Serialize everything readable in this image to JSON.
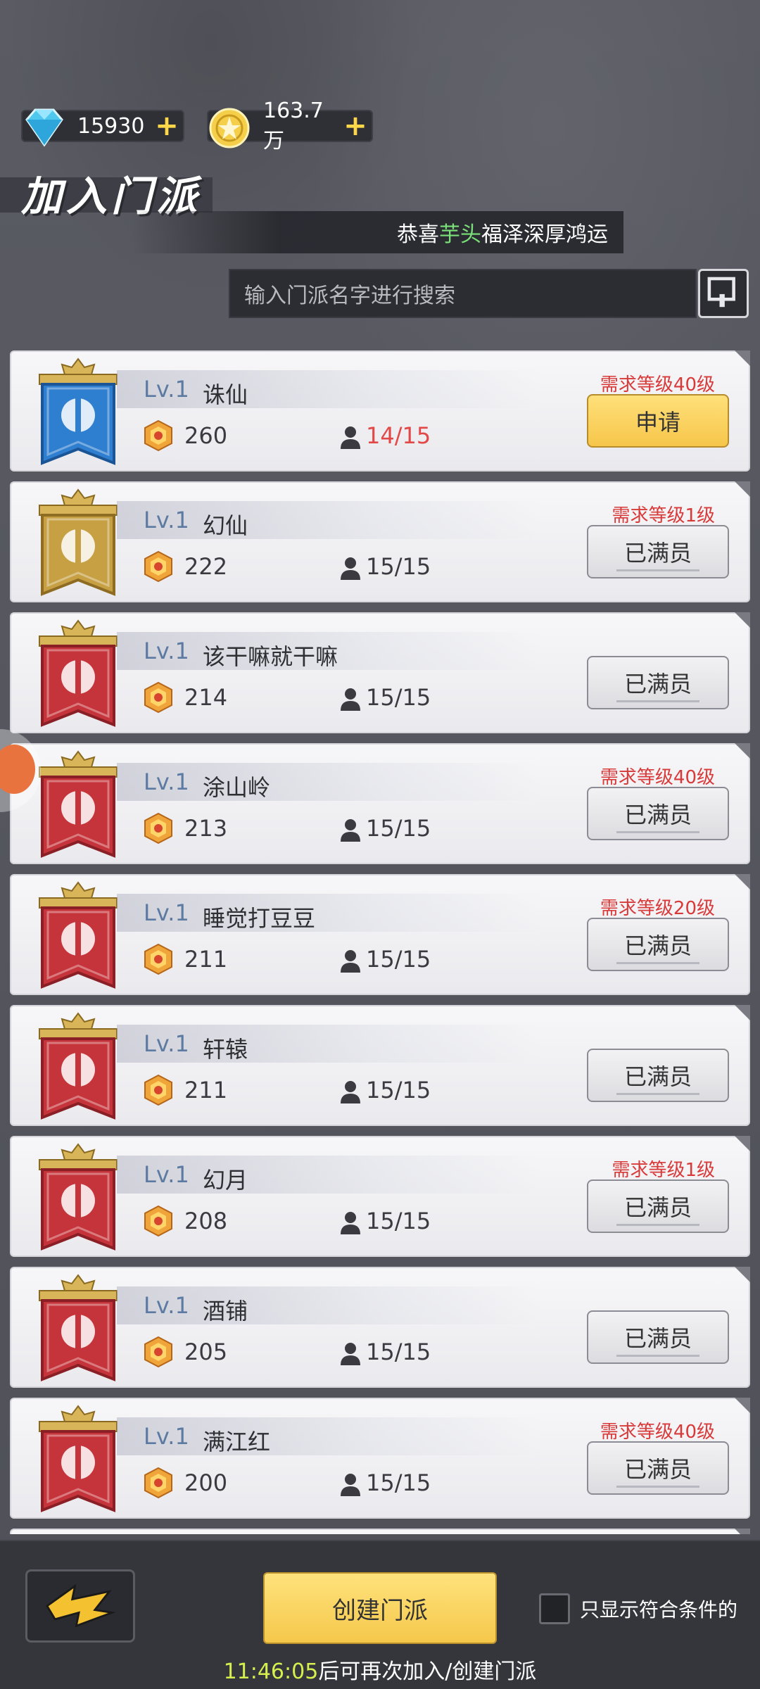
{
  "currency": {
    "diamond": {
      "amount": "15930",
      "icon": "diamond-icon"
    },
    "coin": {
      "amount": "163.7万",
      "icon": "coin-icon"
    },
    "plus": "+"
  },
  "header": {
    "title": "加入门派",
    "ticker": {
      "prefix": "恭喜",
      "highlight": "芋头",
      "suffix": "福泽深厚鸿运"
    }
  },
  "search": {
    "placeholder": "输入门派名字进行搜索"
  },
  "guilds": [
    {
      "lv": "Lv.1",
      "name": "诛仙",
      "power": "260",
      "members": "14/15",
      "members_full": false,
      "requirement": "需求等级40级",
      "action": "申请",
      "action_type": "apply",
      "emblem": "blue"
    },
    {
      "lv": "Lv.1",
      "name": "幻仙",
      "power": "222",
      "members": "15/15",
      "members_full": true,
      "requirement": "需求等级1级",
      "action": "已满员",
      "action_type": "full",
      "emblem": "gold"
    },
    {
      "lv": "Lv.1",
      "name": "该干嘛就干嘛",
      "power": "214",
      "members": "15/15",
      "members_full": true,
      "requirement": "",
      "action": "已满员",
      "action_type": "full",
      "emblem": "red"
    },
    {
      "lv": "Lv.1",
      "name": "涂山岭",
      "power": "213",
      "members": "15/15",
      "members_full": true,
      "requirement": "需求等级40级",
      "action": "已满员",
      "action_type": "full",
      "emblem": "red"
    },
    {
      "lv": "Lv.1",
      "name": "睡觉打豆豆",
      "power": "211",
      "members": "15/15",
      "members_full": true,
      "requirement": "需求等级20级",
      "action": "已满员",
      "action_type": "full",
      "emblem": "red"
    },
    {
      "lv": "Lv.1",
      "name": "轩辕",
      "power": "211",
      "members": "15/15",
      "members_full": true,
      "requirement": "",
      "action": "已满员",
      "action_type": "full",
      "emblem": "red"
    },
    {
      "lv": "Lv.1",
      "name": "幻月",
      "power": "208",
      "members": "15/15",
      "members_full": true,
      "requirement": "需求等级1级",
      "action": "已满员",
      "action_type": "full",
      "emblem": "red"
    },
    {
      "lv": "Lv.1",
      "name": "酒铺",
      "power": "205",
      "members": "15/15",
      "members_full": true,
      "requirement": "",
      "action": "已满员",
      "action_type": "full",
      "emblem": "red"
    },
    {
      "lv": "Lv.1",
      "name": "满江红",
      "power": "200",
      "members": "15/15",
      "members_full": true,
      "requirement": "需求等级40级",
      "action": "已满员",
      "action_type": "full",
      "emblem": "red"
    }
  ],
  "bottom": {
    "create_label": "创建门派",
    "filter_label": "只显示符合条件的",
    "filter_checked": false,
    "countdown_time": "11:46:05",
    "countdown_text": "后可再次加入/创建门派"
  },
  "colors": {
    "accent_yellow": "#f6c64a",
    "full_red": "#e24848",
    "highlight_green": "#7be07a",
    "lv_blue": "#5c7aa2",
    "timer_yellow": "#d6ef4f"
  }
}
